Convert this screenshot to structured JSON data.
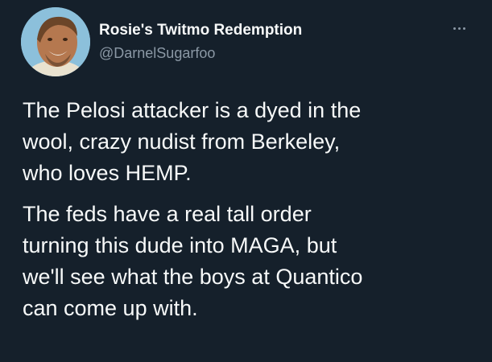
{
  "user": {
    "display_name": "Rosie's Twitmo Redemption",
    "handle": "@DarnelSugarfoo",
    "avatar_icon": "profile-photo"
  },
  "tweet": {
    "paragraphs": [
      "The Pelosi attacker is a dyed in the\nwool, crazy nudist from Berkeley,\nwho loves HEMP.",
      "The feds have a real tall order\nturning this dude into MAGA, but\nwe'll see what the boys at Quantico\ncan come up with."
    ]
  },
  "menu": {
    "icon": "more-options-icon"
  },
  "colors": {
    "background": "#15202b",
    "text": "#f7f9f9",
    "secondary_text": "#8b98a5"
  }
}
